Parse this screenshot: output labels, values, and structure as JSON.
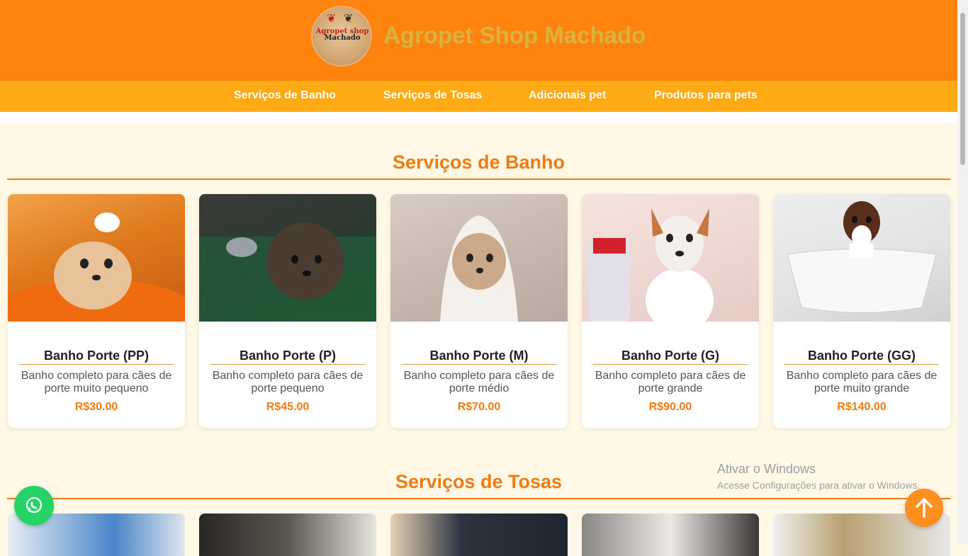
{
  "header": {
    "brand_title": "Agropet Shop Machado",
    "logo_text_top": "Agropet shop",
    "logo_text_bottom": "Machado"
  },
  "nav": {
    "items": [
      {
        "label": "Serviços de Banho"
      },
      {
        "label": "Serviços de Tosas"
      },
      {
        "label": "Adicionais pet"
      },
      {
        "label": "Produtos para pets"
      }
    ]
  },
  "sections": {
    "banho": {
      "title": "Serviços de Banho",
      "cards": [
        {
          "name": "Banho Porte (PP)",
          "desc": "Banho completo para cães de porte muito pequeno",
          "price": "R$30.00"
        },
        {
          "name": "Banho Porte (P)",
          "desc": "Banho completo para cães de porte pequeno",
          "price": "R$45.00"
        },
        {
          "name": "Banho Porte (M)",
          "desc": "Banho completo para cães de porte médio",
          "price": "R$70.00"
        },
        {
          "name": "Banho Porte (G)",
          "desc": "Banho completo para cães de porte grande",
          "price": "R$90.00"
        },
        {
          "name": "Banho Porte (GG)",
          "desc": "Banho completo para cães de porte muito grande",
          "price": "R$140.00"
        }
      ]
    },
    "tosas": {
      "title": "Serviços de Tosas"
    }
  },
  "watermark": {
    "line1": "Ativar o Windows",
    "line2": "Acesse Configurações para ativar o Windows."
  },
  "icons": {
    "whatsapp": "whatsapp-icon",
    "scroll_top": "arrow-up-icon"
  },
  "colors": {
    "header": "#ff830f",
    "nav": "#fdaa15",
    "accent": "#f07b10",
    "brand_title": "#d9b33c",
    "whatsapp": "#25d366"
  }
}
